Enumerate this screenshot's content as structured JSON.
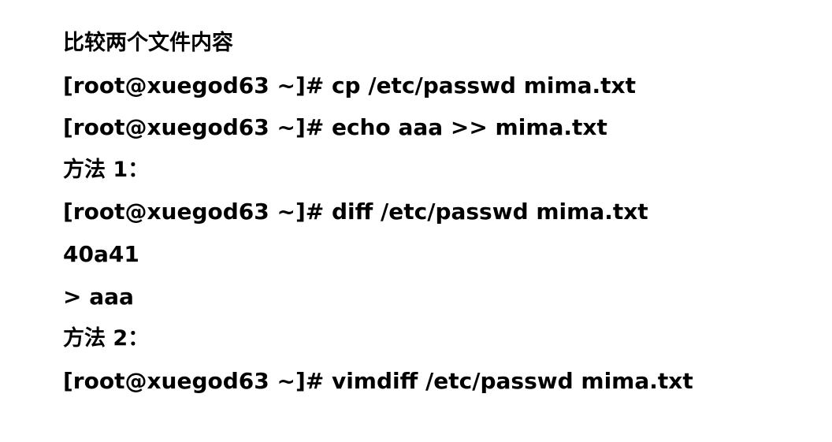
{
  "document": {
    "title": "比较两个文件内容",
    "lines": [
      "[root@xuegod63 ~]# cp /etc/passwd mima.txt",
      "[root@xuegod63 ~]# echo aaa >> mima.txt",
      "方法 1：",
      "[root@xuegod63 ~]# diff /etc/passwd mima.txt",
      "40a41",
      "> aaa",
      "方法 2：",
      "[root@xuegod63 ~]# vimdiff /etc/passwd mima.txt"
    ]
  }
}
